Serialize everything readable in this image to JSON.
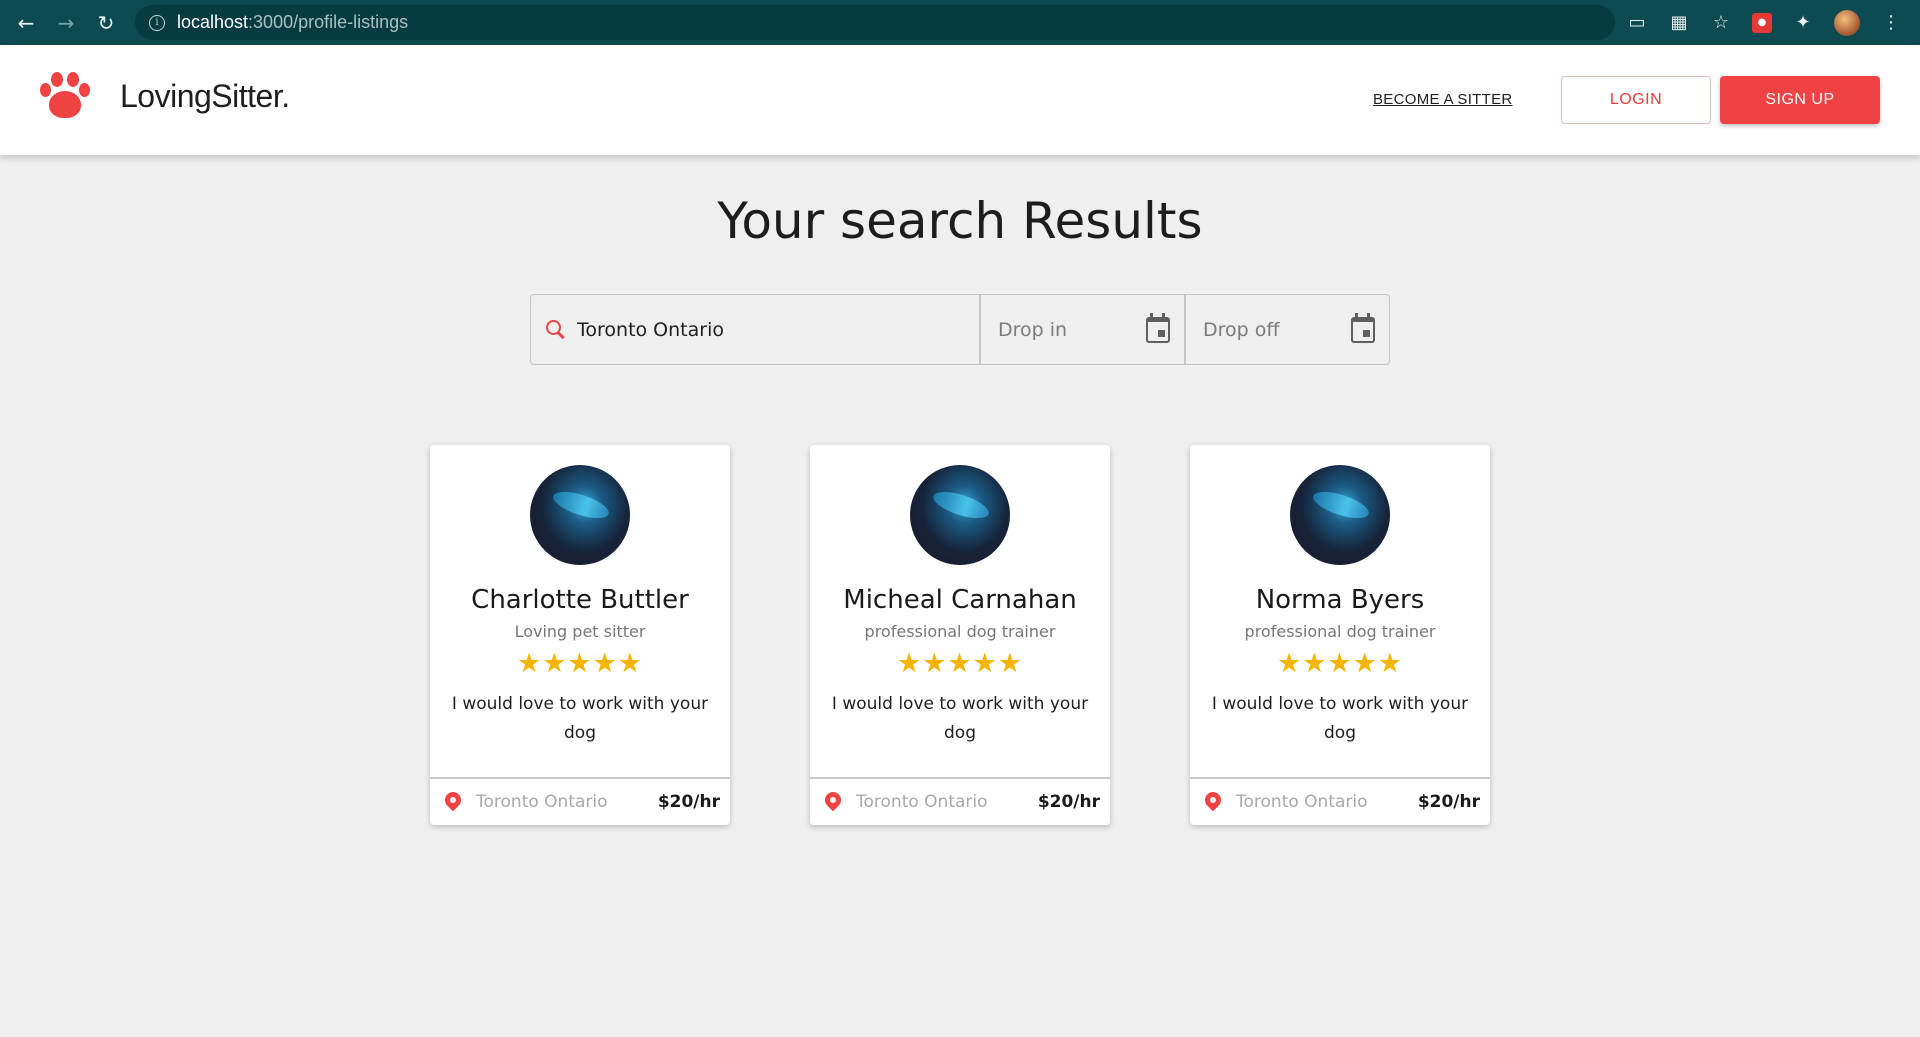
{
  "browser": {
    "url_host": "localhost",
    "url_path": ":3000/profile-listings"
  },
  "header": {
    "brand": "LovingSitter.",
    "become_sitter": "BECOME A SITTER",
    "login": "LOGIN",
    "signup": "SIGN UP",
    "brand_color": "#f04242"
  },
  "page": {
    "title": "Your search Results"
  },
  "search": {
    "location_value": "Toronto Ontario",
    "drop_in_placeholder": "Drop in",
    "drop_off_placeholder": "Drop off"
  },
  "cards": [
    {
      "name": "Charlotte Buttler",
      "title": "Loving pet sitter",
      "rating": 5,
      "stars": "★★★★★",
      "bio": "I would love to work with your dog",
      "location": "Toronto Ontario",
      "rate": "$20/hr"
    },
    {
      "name": "Micheal Carnahan",
      "title": "professional dog trainer",
      "rating": 5,
      "stars": "★★★★★",
      "bio": "I would love to work with your dog",
      "location": "Toronto Ontario",
      "rate": "$20/hr"
    },
    {
      "name": "Norma Byers",
      "title": "professional dog trainer",
      "rating": 5,
      "stars": "★★★★★",
      "bio": "I would love to work with your dog",
      "location": "Toronto Ontario",
      "rate": "$20/hr"
    }
  ]
}
